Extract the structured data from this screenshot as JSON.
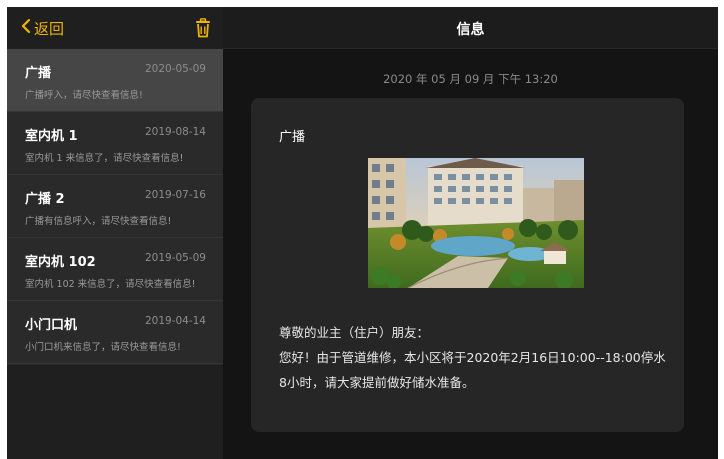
{
  "header": {
    "back_label": "返回",
    "title": "信息"
  },
  "icons": {
    "back": "chevron-left-icon",
    "delete": "trash-icon"
  },
  "colors": {
    "accent": "#f0b400",
    "background": "#121212",
    "list_background": "#2a2a2a",
    "selected_item": "#464646",
    "card": "#262626"
  },
  "messages": [
    {
      "title": "广播",
      "date": "2020-05-09",
      "preview": "广播呼入，请尽快查看信息!",
      "selected": true
    },
    {
      "title": "室内机 1",
      "date": "2019-08-14",
      "preview": "室内机 1 来信息了，请尽快查看信息!",
      "selected": false
    },
    {
      "title": "广播 2",
      "date": "2019-07-16",
      "preview": "广播有信息呼入，请尽快查看信息!",
      "selected": false
    },
    {
      "title": "室内机 102",
      "date": "2019-05-09",
      "preview": "室内机 102 来信息了，请尽快查看信息!",
      "selected": false
    },
    {
      "title": "小门口机",
      "date": "2019-04-14",
      "preview": "小门口机来信息了，请尽快查看信息!",
      "selected": false
    }
  ],
  "detail": {
    "timestamp": "2020 年 05 月 09 月 下午 13:20",
    "title": "广播",
    "body_lines": [
      "尊敬的业主（住户）朋友：",
      "您好！由于管道维修，本小区将于2020年2月16日10:00--18:00停水",
      "8小时，请大家提前做好储水准备。"
    ]
  }
}
